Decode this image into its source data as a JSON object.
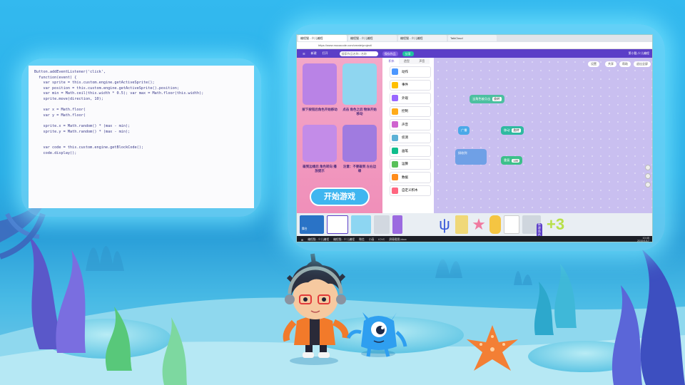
{
  "colors": {
    "ocean_top": "#33b9ef",
    "app_purple": "#5b3ec7",
    "workspace": "#c9bff0",
    "start_button": "#3fb6f0"
  },
  "browser": {
    "tabs": [
      "编程猫 - 少儿编程",
      "编程猫 - 少儿编程",
      "编程猫 - 少儿编程",
      "TalkCloud"
    ],
    "url": "https://www.mocacode.com/create/project/"
  },
  "toolbar": {
    "file": "新建",
    "open": "打开",
    "search_placeholder": "搜索作品名称 / 名称",
    "save": "保存作品",
    "share": "分享",
    "user": "第小酷-少儿编程"
  },
  "tutorial": {
    "card_texts": [
      "按下按钮后角色开始移动",
      "点击 角色之后 物体开始移动",
      "碰到边缘后 角色转向 播放提示",
      "注意：不要碰到 左右边缘"
    ],
    "start_button": "开始游戏"
  },
  "category_tabs": [
    "积木",
    "造型",
    "声音"
  ],
  "categories": [
    {
      "label": "动作",
      "color": "#4c97ff"
    },
    {
      "label": "事件",
      "color": "#ffbf00"
    },
    {
      "label": "外观",
      "color": "#9966ff"
    },
    {
      "label": "控制",
      "color": "#ffab19"
    },
    {
      "label": "声音",
      "color": "#cf63cf"
    },
    {
      "label": "侦测",
      "color": "#5cb1d6"
    },
    {
      "label": "画笔",
      "color": "#0fbd8c"
    },
    {
      "label": "运算",
      "color": "#59c059"
    },
    {
      "label": "数据",
      "color": "#ff8c1a"
    },
    {
      "label": "自定义积木",
      "color": "#ff6680"
    }
  ],
  "workspace": {
    "buttons": [
      "设置",
      "共享",
      "帮助",
      "退出全屏"
    ],
    "blocks": {
      "when_clicked": "当角色被点击",
      "forever": "重复",
      "broadcast": "广播",
      "receive": "接收到",
      "move": "移动",
      "turn": "旋转",
      "value": "100"
    },
    "stage_label": "舞台",
    "upload_label": "新建角色"
  },
  "taskbar": {
    "items": [
      "编程猫 - 少儿编程",
      "编程猫 - 少儿编程",
      "微信",
      "小画",
      "ICVC",
      "屏幕截图.docx"
    ],
    "time": "10:45",
    "date": "2019/1/17"
  },
  "plus_badge": "+3",
  "code_lines": [
    "Button.addEventListener('click',",
    "  function(event) {",
    "    var sprite = this.custom.engine.getActiveSprite();",
    "    var position = this.custom.engine.getActiveSprite().position;",
    "    var min = Math.ceil(this.width * 0.5); var max = Math.floor(this.width);",
    "    sprite.move(direction, 10);",
    "",
    "    var x = Math.floor(",
    "    var y = Math.floor(",
    "",
    "    sprite.x = Math.random() * (max - min);",
    "    sprite.y = Math.random() * (max - min);",
    "",
    "",
    "    var code = this.custom.engine.getBlockCode();",
    "    code.display();"
  ]
}
